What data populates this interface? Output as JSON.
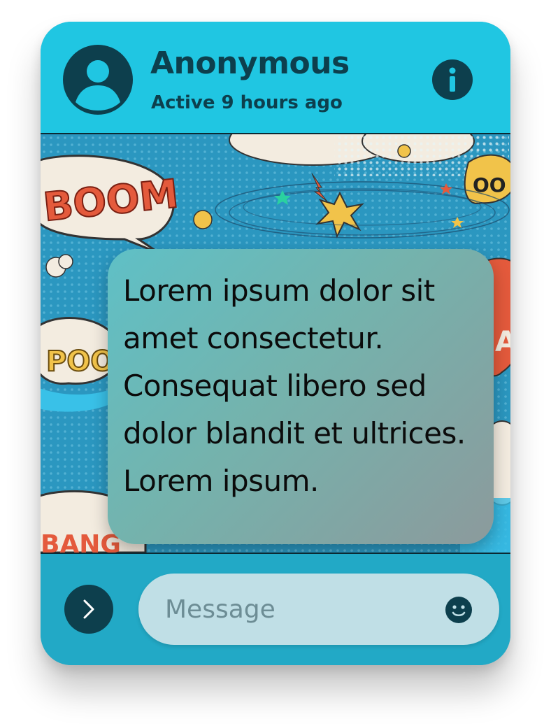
{
  "header": {
    "contact_name": "Anonymous",
    "status": "Active 9 hours ago",
    "avatar_icon": "user-avatar-icon",
    "info_icon": "info-icon"
  },
  "chat": {
    "background": "comic-pop-art-pattern",
    "messages": [
      {
        "text": "Lorem ipsum dolor sit amet consectetur. Consequat libero sed dolor blandit et ultrices. Lorem ipsum."
      }
    ]
  },
  "composer": {
    "placeholder": "Message",
    "value": "",
    "send_icon": "chevron-right-icon",
    "emoji_icon": "smiley-icon"
  },
  "colors": {
    "header_bg": "#20c6e2",
    "footer_bg": "#22a9c6",
    "accent_dark": "#0d3f4d",
    "input_bg": "#c0dfe6"
  }
}
